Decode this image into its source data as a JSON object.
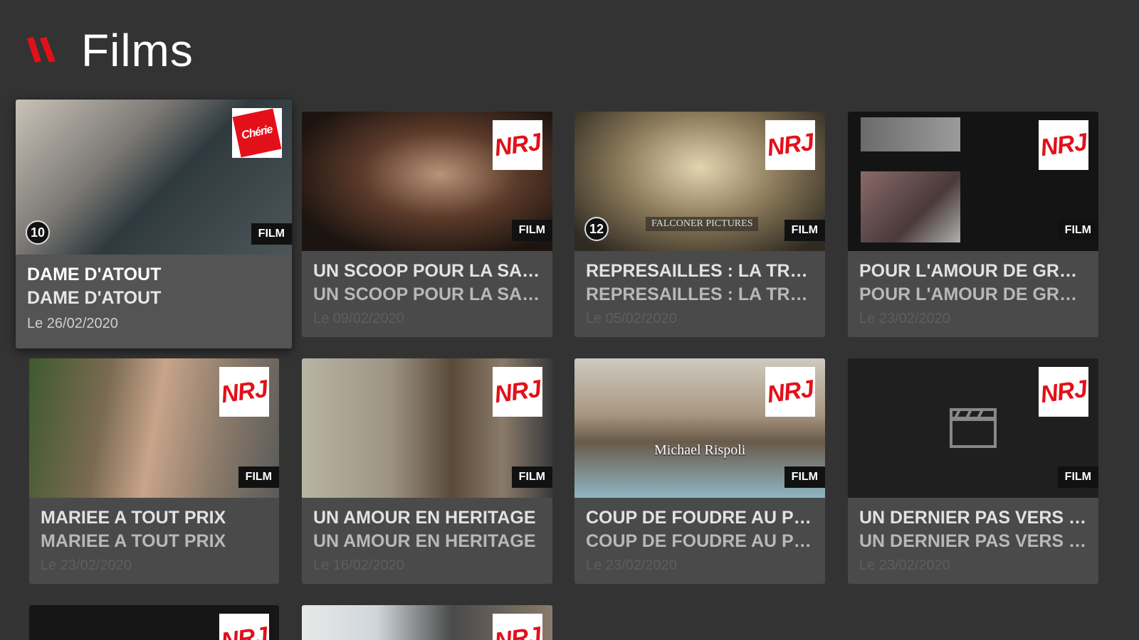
{
  "header": {
    "title": "Films",
    "logo_icon": "red-slashes-logo-icon",
    "accent": "#e3101a"
  },
  "cards": [
    {
      "title": "DAME D'ATOUT",
      "subtitle": "DAME D'ATOUT",
      "date": "Le 26/02/2020",
      "channel": "Chérie 25",
      "badge": "FILM",
      "age": "10",
      "focused": true
    },
    {
      "title": "UN SCOOP POUR LA SAI...",
      "subtitle": "UN SCOOP POUR LA SAI...",
      "date": "Le 09/02/2020",
      "channel": "NRJ12",
      "badge": "FILM"
    },
    {
      "title": "REPRESAILLES : LA TRA...",
      "subtitle": "REPRESAILLES : LA TRA...",
      "date": "Le 05/02/2020",
      "channel": "NRJ12",
      "badge": "FILM",
      "age": "12",
      "overlay_text": "FALCONER PICTURES"
    },
    {
      "title": "POUR L'AMOUR DE GRACE",
      "subtitle": "POUR L'AMOUR DE GRACE",
      "date": "Le 23/02/2020",
      "channel": "NRJ12",
      "badge": "FILM"
    },
    {
      "title": "MARIEE A TOUT PRIX",
      "subtitle": "MARIEE A TOUT PRIX",
      "date": "Le 23/02/2020",
      "channel": "NRJ12",
      "badge": "FILM"
    },
    {
      "title": "UN AMOUR EN HERITAGE",
      "subtitle": "UN AMOUR EN HERITAGE",
      "date": "Le 16/02/2020",
      "channel": "NRJ12",
      "badge": "FILM"
    },
    {
      "title": "COUP DE FOUDRE AU PL...",
      "subtitle": "COUP DE FOUDRE AU PL...",
      "date": "Le 23/02/2020",
      "channel": "NRJ12",
      "badge": "FILM",
      "overlay_text": "Michael Rispoli"
    },
    {
      "title": "UN DERNIER PAS VERS L...",
      "subtitle": "UN DERNIER PAS VERS L'...",
      "date": "Le 23/02/2020",
      "channel": "NRJ12",
      "badge": "FILM",
      "placeholder_icon": "clapperboard-icon"
    },
    {
      "channel": "NRJ12"
    },
    {
      "channel": "NRJ12"
    }
  ]
}
